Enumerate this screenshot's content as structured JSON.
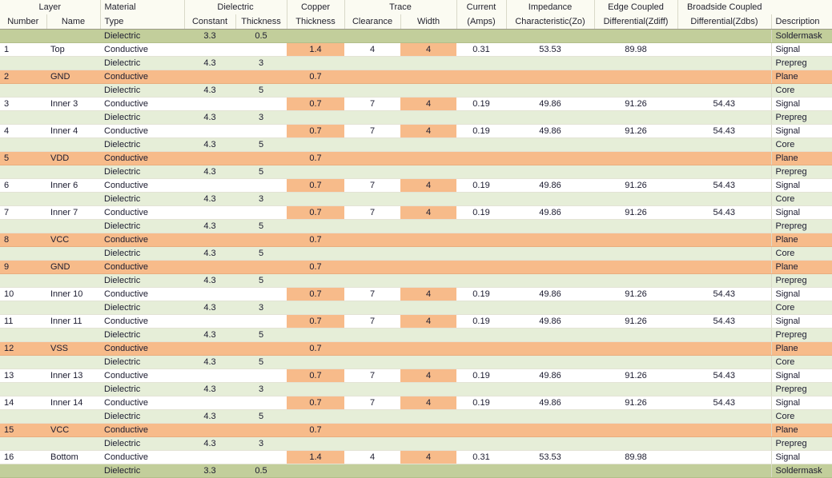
{
  "table": {
    "groups": [
      {
        "label": "Layer",
        "span": 2
      },
      {
        "label": "Material",
        "span": 1,
        "align": "left"
      },
      {
        "label": "Dielectric",
        "span": 2
      },
      {
        "label": "Copper",
        "span": 1
      },
      {
        "label": "Trace",
        "span": 2
      },
      {
        "label": "Current",
        "span": 1
      },
      {
        "label": "Impedance",
        "span": 1
      },
      {
        "label": "Edge Coupled",
        "span": 1
      },
      {
        "label": "Broadside Coupled",
        "span": 1
      },
      {
        "label": "",
        "span": 1
      }
    ],
    "columns": [
      "Number",
      "Name",
      "Type",
      "Constant",
      "Thickness",
      "Thickness",
      "Clearance",
      "Width",
      "(Amps)",
      "Characteristic(Zo)",
      "Differential(Zdiff)",
      "Differential(Zdbs)",
      "Description"
    ],
    "rows": [
      {
        "kind": "mask",
        "number": "",
        "name": "",
        "type": "Dielectric",
        "constant": "3.3",
        "dthick": "0.5",
        "cthick": "",
        "clearance": "",
        "width": "",
        "current": "",
        "zo": "",
        "zdiff": "",
        "zdbs": "",
        "description": "Soldermask"
      },
      {
        "kind": "signal",
        "number": "1",
        "name": "Top",
        "type": "Conductive",
        "constant": "",
        "dthick": "",
        "cthick": "1.4",
        "clearance": "4",
        "width": "4",
        "current": "0.31",
        "zo": "53.53",
        "zdiff": "89.98",
        "zdbs": "",
        "description": "Signal"
      },
      {
        "kind": "diel",
        "number": "",
        "name": "",
        "type": "Dielectric",
        "constant": "4.3",
        "dthick": "3",
        "cthick": "",
        "clearance": "",
        "width": "",
        "current": "",
        "zo": "",
        "zdiff": "",
        "zdbs": "",
        "description": "Prepreg"
      },
      {
        "kind": "plane",
        "number": "2",
        "name": "GND",
        "type": "Conductive",
        "constant": "",
        "dthick": "",
        "cthick": "0.7",
        "clearance": "",
        "width": "",
        "current": "",
        "zo": "",
        "zdiff": "",
        "zdbs": "",
        "description": "Plane"
      },
      {
        "kind": "diel",
        "number": "",
        "name": "",
        "type": "Dielectric",
        "constant": "4.3",
        "dthick": "5",
        "cthick": "",
        "clearance": "",
        "width": "",
        "current": "",
        "zo": "",
        "zdiff": "",
        "zdbs": "",
        "description": "Core"
      },
      {
        "kind": "signal",
        "number": "3",
        "name": "Inner 3",
        "type": "Conductive",
        "constant": "",
        "dthick": "",
        "cthick": "0.7",
        "clearance": "7",
        "width": "4",
        "current": "0.19",
        "zo": "49.86",
        "zdiff": "91.26",
        "zdbs": "54.43",
        "description": "Signal"
      },
      {
        "kind": "diel",
        "number": "",
        "name": "",
        "type": "Dielectric",
        "constant": "4.3",
        "dthick": "3",
        "cthick": "",
        "clearance": "",
        "width": "",
        "current": "",
        "zo": "",
        "zdiff": "",
        "zdbs": "",
        "description": "Prepreg"
      },
      {
        "kind": "signal",
        "number": "4",
        "name": "Inner 4",
        "type": "Conductive",
        "constant": "",
        "dthick": "",
        "cthick": "0.7",
        "clearance": "7",
        "width": "4",
        "current": "0.19",
        "zo": "49.86",
        "zdiff": "91.26",
        "zdbs": "54.43",
        "description": "Signal"
      },
      {
        "kind": "diel",
        "number": "",
        "name": "",
        "type": "Dielectric",
        "constant": "4.3",
        "dthick": "5",
        "cthick": "",
        "clearance": "",
        "width": "",
        "current": "",
        "zo": "",
        "zdiff": "",
        "zdbs": "",
        "description": "Core"
      },
      {
        "kind": "plane",
        "number": "5",
        "name": "VDD",
        "type": "Conductive",
        "constant": "",
        "dthick": "",
        "cthick": "0.7",
        "clearance": "",
        "width": "",
        "current": "",
        "zo": "",
        "zdiff": "",
        "zdbs": "",
        "description": "Plane"
      },
      {
        "kind": "diel",
        "number": "",
        "name": "",
        "type": "Dielectric",
        "constant": "4.3",
        "dthick": "5",
        "cthick": "",
        "clearance": "",
        "width": "",
        "current": "",
        "zo": "",
        "zdiff": "",
        "zdbs": "",
        "description": "Prepreg"
      },
      {
        "kind": "signal",
        "number": "6",
        "name": "Inner 6",
        "type": "Conductive",
        "constant": "",
        "dthick": "",
        "cthick": "0.7",
        "clearance": "7",
        "width": "4",
        "current": "0.19",
        "zo": "49.86",
        "zdiff": "91.26",
        "zdbs": "54.43",
        "description": "Signal"
      },
      {
        "kind": "diel",
        "number": "",
        "name": "",
        "type": "Dielectric",
        "constant": "4.3",
        "dthick": "3",
        "cthick": "",
        "clearance": "",
        "width": "",
        "current": "",
        "zo": "",
        "zdiff": "",
        "zdbs": "",
        "description": "Core"
      },
      {
        "kind": "signal",
        "number": "7",
        "name": "Inner 7",
        "type": "Conductive",
        "constant": "",
        "dthick": "",
        "cthick": "0.7",
        "clearance": "7",
        "width": "4",
        "current": "0.19",
        "zo": "49.86",
        "zdiff": "91.26",
        "zdbs": "54.43",
        "description": "Signal"
      },
      {
        "kind": "diel",
        "number": "",
        "name": "",
        "type": "Dielectric",
        "constant": "4.3",
        "dthick": "5",
        "cthick": "",
        "clearance": "",
        "width": "",
        "current": "",
        "zo": "",
        "zdiff": "",
        "zdbs": "",
        "description": "Prepreg"
      },
      {
        "kind": "plane",
        "number": "8",
        "name": "VCC",
        "type": "Conductive",
        "constant": "",
        "dthick": "",
        "cthick": "0.7",
        "clearance": "",
        "width": "",
        "current": "",
        "zo": "",
        "zdiff": "",
        "zdbs": "",
        "description": "Plane"
      },
      {
        "kind": "diel",
        "number": "",
        "name": "",
        "type": "Dielectric",
        "constant": "4.3",
        "dthick": "5",
        "cthick": "",
        "clearance": "",
        "width": "",
        "current": "",
        "zo": "",
        "zdiff": "",
        "zdbs": "",
        "description": "Core"
      },
      {
        "kind": "plane",
        "number": "9",
        "name": "GND",
        "type": "Conductive",
        "constant": "",
        "dthick": "",
        "cthick": "0.7",
        "clearance": "",
        "width": "",
        "current": "",
        "zo": "",
        "zdiff": "",
        "zdbs": "",
        "description": "Plane"
      },
      {
        "kind": "diel",
        "number": "",
        "name": "",
        "type": "Dielectric",
        "constant": "4.3",
        "dthick": "5",
        "cthick": "",
        "clearance": "",
        "width": "",
        "current": "",
        "zo": "",
        "zdiff": "",
        "zdbs": "",
        "description": "Prepreg"
      },
      {
        "kind": "signal",
        "number": "10",
        "name": "Inner 10",
        "type": "Conductive",
        "constant": "",
        "dthick": "",
        "cthick": "0.7",
        "clearance": "7",
        "width": "4",
        "current": "0.19",
        "zo": "49.86",
        "zdiff": "91.26",
        "zdbs": "54.43",
        "description": "Signal"
      },
      {
        "kind": "diel",
        "number": "",
        "name": "",
        "type": "Dielectric",
        "constant": "4.3",
        "dthick": "3",
        "cthick": "",
        "clearance": "",
        "width": "",
        "current": "",
        "zo": "",
        "zdiff": "",
        "zdbs": "",
        "description": "Core"
      },
      {
        "kind": "signal",
        "number": "11",
        "name": "Inner 11",
        "type": "Conductive",
        "constant": "",
        "dthick": "",
        "cthick": "0.7",
        "clearance": "7",
        "width": "4",
        "current": "0.19",
        "zo": "49.86",
        "zdiff": "91.26",
        "zdbs": "54.43",
        "description": "Signal"
      },
      {
        "kind": "diel",
        "number": "",
        "name": "",
        "type": "Dielectric",
        "constant": "4.3",
        "dthick": "5",
        "cthick": "",
        "clearance": "",
        "width": "",
        "current": "",
        "zo": "",
        "zdiff": "",
        "zdbs": "",
        "description": "Prepreg"
      },
      {
        "kind": "plane",
        "number": "12",
        "name": "VSS",
        "type": "Conductive",
        "constant": "",
        "dthick": "",
        "cthick": "0.7",
        "clearance": "",
        "width": "",
        "current": "",
        "zo": "",
        "zdiff": "",
        "zdbs": "",
        "description": "Plane"
      },
      {
        "kind": "diel",
        "number": "",
        "name": "",
        "type": "Dielectric",
        "constant": "4.3",
        "dthick": "5",
        "cthick": "",
        "clearance": "",
        "width": "",
        "current": "",
        "zo": "",
        "zdiff": "",
        "zdbs": "",
        "description": "Core"
      },
      {
        "kind": "signal",
        "number": "13",
        "name": "Inner 13",
        "type": "Conductive",
        "constant": "",
        "dthick": "",
        "cthick": "0.7",
        "clearance": "7",
        "width": "4",
        "current": "0.19",
        "zo": "49.86",
        "zdiff": "91.26",
        "zdbs": "54.43",
        "description": "Signal"
      },
      {
        "kind": "diel",
        "number": "",
        "name": "",
        "type": "Dielectric",
        "constant": "4.3",
        "dthick": "3",
        "cthick": "",
        "clearance": "",
        "width": "",
        "current": "",
        "zo": "",
        "zdiff": "",
        "zdbs": "",
        "description": "Prepreg"
      },
      {
        "kind": "signal",
        "number": "14",
        "name": "Inner 14",
        "type": "Conductive",
        "constant": "",
        "dthick": "",
        "cthick": "0.7",
        "clearance": "7",
        "width": "4",
        "current": "0.19",
        "zo": "49.86",
        "zdiff": "91.26",
        "zdbs": "54.43",
        "description": "Signal"
      },
      {
        "kind": "diel",
        "number": "",
        "name": "",
        "type": "Dielectric",
        "constant": "4.3",
        "dthick": "5",
        "cthick": "",
        "clearance": "",
        "width": "",
        "current": "",
        "zo": "",
        "zdiff": "",
        "zdbs": "",
        "description": "Core"
      },
      {
        "kind": "plane",
        "number": "15",
        "name": "VCC",
        "type": "Conductive",
        "constant": "",
        "dthick": "",
        "cthick": "0.7",
        "clearance": "",
        "width": "",
        "current": "",
        "zo": "",
        "zdiff": "",
        "zdbs": "",
        "description": "Plane"
      },
      {
        "kind": "diel",
        "number": "",
        "name": "",
        "type": "Dielectric",
        "constant": "4.3",
        "dthick": "3",
        "cthick": "",
        "clearance": "",
        "width": "",
        "current": "",
        "zo": "",
        "zdiff": "",
        "zdbs": "",
        "description": "Prepreg"
      },
      {
        "kind": "signal",
        "number": "16",
        "name": "Bottom",
        "type": "Conductive",
        "constant": "",
        "dthick": "",
        "cthick": "1.4",
        "clearance": "4",
        "width": "4",
        "current": "0.31",
        "zo": "53.53",
        "zdiff": "89.98",
        "zdbs": "",
        "description": "Signal"
      },
      {
        "kind": "mask",
        "number": "",
        "name": "",
        "type": "Dielectric",
        "constant": "3.3",
        "dthick": "0.5",
        "cthick": "",
        "clearance": "",
        "width": "",
        "current": "",
        "zo": "",
        "zdiff": "",
        "zdbs": "",
        "description": "Soldermask"
      }
    ]
  },
  "colors": {
    "soldermask": "#c2ce9b",
    "dielectric": "#e6eed8",
    "plane": "#f7bb8a",
    "signal": "#ffffff",
    "highlight": "#f7bb8a",
    "header_bg": "#fbfbf2",
    "grid": "#d9d9c9",
    "text": "#1b1b2f"
  }
}
